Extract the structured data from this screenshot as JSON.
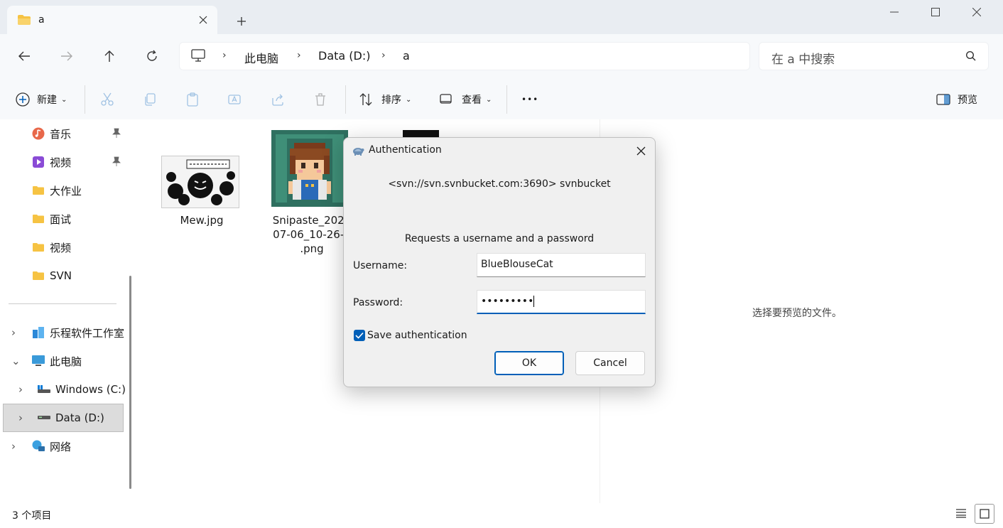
{
  "window": {
    "tab_title": "a",
    "controls": [
      "minimize",
      "maximize",
      "close"
    ]
  },
  "address": {
    "breadcrumbs": [
      "此电脑",
      "Data (D:)",
      "a"
    ],
    "search_placeholder": "在 a 中搜索"
  },
  "toolbar": {
    "new_label": "新建",
    "sort_label": "排序",
    "view_label": "查看",
    "more_label": "•••",
    "preview_label": "预览"
  },
  "sidebar": {
    "items": [
      {
        "label": "音乐",
        "icon": "music-icon",
        "pinned": true
      },
      {
        "label": "视频",
        "icon": "video-icon",
        "pinned": true
      },
      {
        "label": "大作业",
        "icon": "folder-icon"
      },
      {
        "label": "面试",
        "icon": "folder-icon"
      },
      {
        "label": "视频",
        "icon": "folder-icon"
      },
      {
        "label": "SVN",
        "icon": "folder-icon"
      },
      {
        "label": "乐程软件工作室",
        "icon": "cloud-folder-icon"
      },
      {
        "label": "此电脑",
        "icon": "pc-icon"
      },
      {
        "label": "Windows (C:)",
        "icon": "drive-icon"
      },
      {
        "label": "Data (D:)",
        "icon": "drive-icon",
        "selected": true
      },
      {
        "label": "网络",
        "icon": "network-icon"
      }
    ]
  },
  "files": [
    {
      "name": "Mew.jpg"
    },
    {
      "name_lines": [
        "Snipaste_2026",
        "07-06_10-26-0",
        ".png"
      ]
    }
  ],
  "preview": {
    "message": "选择要预览的文件。"
  },
  "status": {
    "item_count": "3 个项目"
  },
  "dialog": {
    "title": "Authentication",
    "realm": "<svn://svn.svnbucket.com:3690> svnbucket",
    "request": "Requests a username and a password",
    "username_label": "Username:",
    "username_value": "BlueBlouseCat",
    "password_label": "Password:",
    "password_value": "•••••••••",
    "save_label": "Save authentication",
    "save_checked": true,
    "ok_label": "OK",
    "cancel_label": "Cancel"
  },
  "colors": {
    "accent": "#005fb8",
    "folder": "#f6c343",
    "titlebar": "#e9edf2"
  }
}
